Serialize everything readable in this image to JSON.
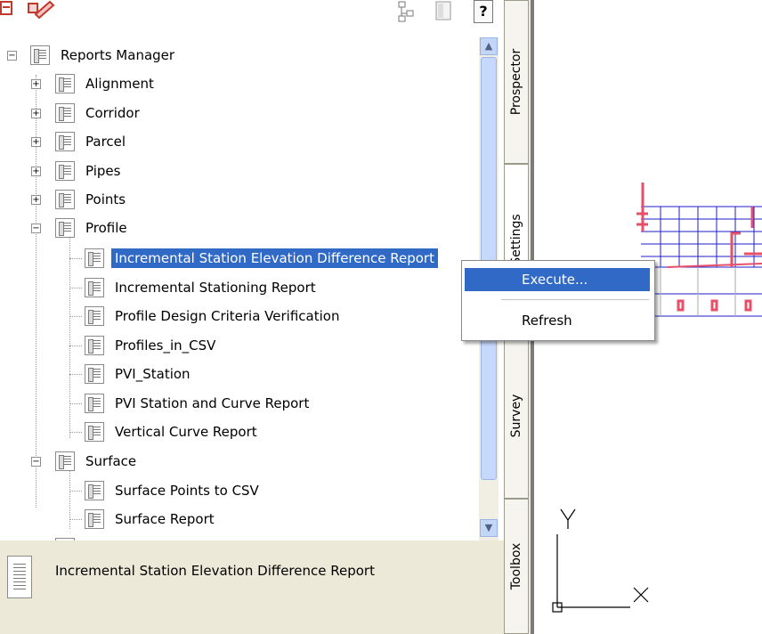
{
  "tree": {
    "root": "Reports Manager",
    "alignment": "Alignment",
    "corridor": "Corridor",
    "parcel": "Parcel",
    "pipes": "Pipes",
    "points": "Points",
    "profile": "Profile",
    "profile_items": [
      "Incremental Station Elevation Difference Report",
      "Incremental Stationing Report",
      "Profile Design Criteria Verification",
      "Profiles_in_CSV",
      "PVI_Station",
      "PVI Station and Curve Report",
      "Vertical Curve Report"
    ],
    "surface": "Surface",
    "surface_items": [
      "Surface Points to CSV",
      "Surface Report"
    ]
  },
  "info": {
    "description": "Incremental Station Elevation Difference Report"
  },
  "tabs": {
    "prospector": "Prospector",
    "settings": "Settings",
    "survey": "Survey",
    "toolbox": "Toolbox"
  },
  "context_menu": {
    "execute": "Execute...",
    "refresh": "Refresh"
  },
  "toolbar": {
    "help": "?"
  },
  "drawing": {
    "axis_y": "Y",
    "axis_x": "X"
  },
  "colors": {
    "selection": "#3169c6",
    "panel_bg": "#ece9d8",
    "drawing_grid": "#1e1ec8",
    "drawing_red": "#e8506a"
  }
}
